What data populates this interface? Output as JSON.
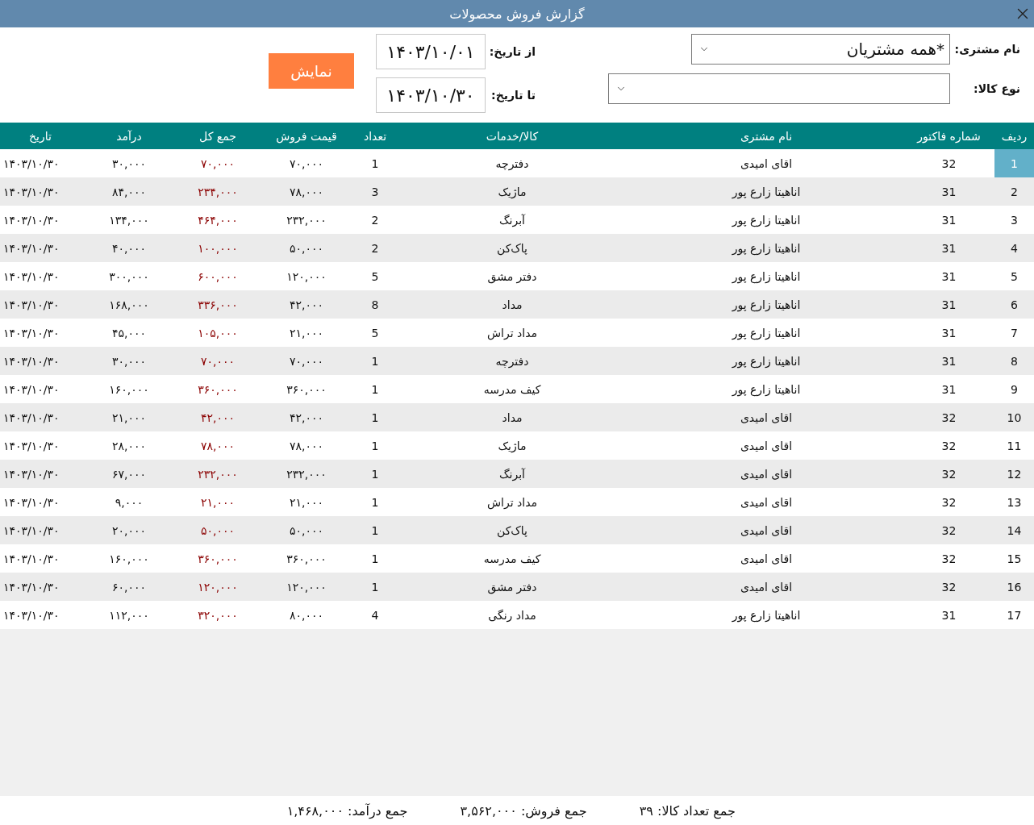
{
  "window": {
    "title": "گزارش فروش محصولات"
  },
  "filters": {
    "customer": {
      "label": "نام مشتری:",
      "value": "*همه مشتریان"
    },
    "product_type": {
      "label": "نوع کالا:"
    },
    "from_date": {
      "label": "از تاریخ:",
      "value": "۱۴۰۳/۱۰/۰۱"
    },
    "to_date": {
      "label": "تا تاریخ:",
      "value": "۱۴۰۳/۱۰/۳۰"
    },
    "show_button": "نمایش"
  },
  "table": {
    "columns": [
      "ردیف",
      "شماره فاکتور",
      "نام مشتری",
      "کالا/خدمات",
      "تعداد",
      "قیمت فروش",
      "جمع کل",
      "درآمد",
      "تاریخ"
    ],
    "rows": [
      {
        "row": "1",
        "invoice": "32",
        "customer": "اقای امیدی",
        "item": "دفترچه",
        "qty": "1",
        "price": "۷۰,۰۰۰",
        "total": "۷۰,۰۰۰",
        "profit": "۳۰,۰۰۰",
        "date": "۱۴۰۳/۱۰/۳۰",
        "selected": true
      },
      {
        "row": "2",
        "invoice": "31",
        "customer": "اناهیتا زارع پور",
        "item": "ماژیک",
        "qty": "3",
        "price": "۷۸,۰۰۰",
        "total": "۲۳۴,۰۰۰",
        "profit": "۸۴,۰۰۰",
        "date": "۱۴۰۳/۱۰/۳۰",
        "selected": false
      },
      {
        "row": "3",
        "invoice": "31",
        "customer": "اناهیتا زارع پور",
        "item": "آبرنگ",
        "qty": "2",
        "price": "۲۳۲,۰۰۰",
        "total": "۴۶۴,۰۰۰",
        "profit": "۱۳۴,۰۰۰",
        "date": "۱۴۰۳/۱۰/۳۰",
        "selected": false
      },
      {
        "row": "4",
        "invoice": "31",
        "customer": "اناهیتا زارع پور",
        "item": "پاک‌کن",
        "qty": "2",
        "price": "۵۰,۰۰۰",
        "total": "۱۰۰,۰۰۰",
        "profit": "۴۰,۰۰۰",
        "date": "۱۴۰۳/۱۰/۳۰",
        "selected": false
      },
      {
        "row": "5",
        "invoice": "31",
        "customer": "اناهیتا زارع پور",
        "item": "دفتر مشق",
        "qty": "5",
        "price": "۱۲۰,۰۰۰",
        "total": "۶۰۰,۰۰۰",
        "profit": "۳۰۰,۰۰۰",
        "date": "۱۴۰۳/۱۰/۳۰",
        "selected": false
      },
      {
        "row": "6",
        "invoice": "31",
        "customer": "اناهیتا زارع پور",
        "item": "مداد",
        "qty": "8",
        "price": "۴۲,۰۰۰",
        "total": "۳۳۶,۰۰۰",
        "profit": "۱۶۸,۰۰۰",
        "date": "۱۴۰۳/۱۰/۳۰",
        "selected": false
      },
      {
        "row": "7",
        "invoice": "31",
        "customer": "اناهیتا زارع پور",
        "item": "مداد تراش",
        "qty": "5",
        "price": "۲۱,۰۰۰",
        "total": "۱۰۵,۰۰۰",
        "profit": "۴۵,۰۰۰",
        "date": "۱۴۰۳/۱۰/۳۰",
        "selected": false
      },
      {
        "row": "8",
        "invoice": "31",
        "customer": "اناهیتا زارع پور",
        "item": "دفترچه",
        "qty": "1",
        "price": "۷۰,۰۰۰",
        "total": "۷۰,۰۰۰",
        "profit": "۳۰,۰۰۰",
        "date": "۱۴۰۳/۱۰/۳۰",
        "selected": false
      },
      {
        "row": "9",
        "invoice": "31",
        "customer": "اناهیتا زارع پور",
        "item": "کیف مدرسه",
        "qty": "1",
        "price": "۳۶۰,۰۰۰",
        "total": "۳۶۰,۰۰۰",
        "profit": "۱۶۰,۰۰۰",
        "date": "۱۴۰۳/۱۰/۳۰",
        "selected": false
      },
      {
        "row": "10",
        "invoice": "32",
        "customer": "اقای امیدی",
        "item": "مداد",
        "qty": "1",
        "price": "۴۲,۰۰۰",
        "total": "۴۲,۰۰۰",
        "profit": "۲۱,۰۰۰",
        "date": "۱۴۰۳/۱۰/۳۰",
        "selected": false
      },
      {
        "row": "11",
        "invoice": "32",
        "customer": "اقای امیدی",
        "item": "ماژیک",
        "qty": "1",
        "price": "۷۸,۰۰۰",
        "total": "۷۸,۰۰۰",
        "profit": "۲۸,۰۰۰",
        "date": "۱۴۰۳/۱۰/۳۰",
        "selected": false
      },
      {
        "row": "12",
        "invoice": "32",
        "customer": "اقای امیدی",
        "item": "آبرنگ",
        "qty": "1",
        "price": "۲۳۲,۰۰۰",
        "total": "۲۳۲,۰۰۰",
        "profit": "۶۷,۰۰۰",
        "date": "۱۴۰۳/۱۰/۳۰",
        "selected": false
      },
      {
        "row": "13",
        "invoice": "32",
        "customer": "اقای امیدی",
        "item": "مداد تراش",
        "qty": "1",
        "price": "۲۱,۰۰۰",
        "total": "۲۱,۰۰۰",
        "profit": "۹,۰۰۰",
        "date": "۱۴۰۳/۱۰/۳۰",
        "selected": false
      },
      {
        "row": "14",
        "invoice": "32",
        "customer": "اقای امیدی",
        "item": "پاک‌کن",
        "qty": "1",
        "price": "۵۰,۰۰۰",
        "total": "۵۰,۰۰۰",
        "profit": "۲۰,۰۰۰",
        "date": "۱۴۰۳/۱۰/۳۰",
        "selected": false
      },
      {
        "row": "15",
        "invoice": "32",
        "customer": "اقای امیدی",
        "item": "کیف مدرسه",
        "qty": "1",
        "price": "۳۶۰,۰۰۰",
        "total": "۳۶۰,۰۰۰",
        "profit": "۱۶۰,۰۰۰",
        "date": "۱۴۰۳/۱۰/۳۰",
        "selected": false
      },
      {
        "row": "16",
        "invoice": "32",
        "customer": "اقای امیدی",
        "item": "دفتر مشق",
        "qty": "1",
        "price": "۱۲۰,۰۰۰",
        "total": "۱۲۰,۰۰۰",
        "profit": "۶۰,۰۰۰",
        "date": "۱۴۰۳/۱۰/۳۰",
        "selected": false
      },
      {
        "row": "17",
        "invoice": "31",
        "customer": "اناهیتا زارع پور",
        "item": "مداد رنگی",
        "qty": "4",
        "price": "۸۰,۰۰۰",
        "total": "۳۲۰,۰۰۰",
        "profit": "۱۱۲,۰۰۰",
        "date": "۱۴۰۳/۱۰/۳۰",
        "selected": false
      }
    ]
  },
  "summary": [
    "جمع تعداد کالا: ۳۹",
    "جمع فروش: ۳,۵۶۲,۰۰۰",
    "جمع درآمد: ۱,۴۶۸,۰۰۰"
  ]
}
